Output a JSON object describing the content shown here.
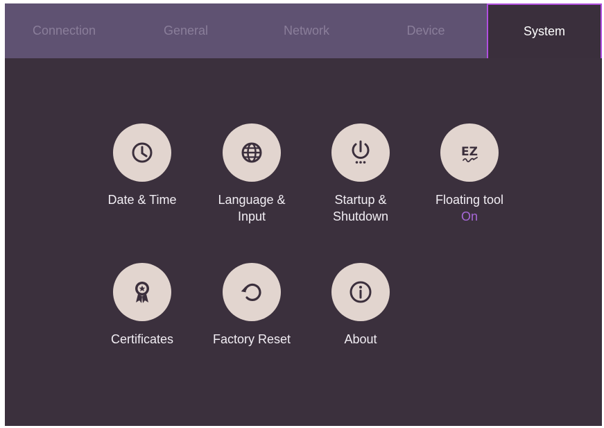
{
  "tabs": [
    {
      "label": "Connection"
    },
    {
      "label": "General"
    },
    {
      "label": "Network"
    },
    {
      "label": "Device"
    },
    {
      "label": "System"
    }
  ],
  "active_tab": "System",
  "items": {
    "date_time": {
      "label": "Date & Time",
      "icon": "clock-icon"
    },
    "language_input": {
      "label": "Language &\nInput",
      "icon": "globe-icon"
    },
    "startup_shutdown": {
      "label": "Startup &\nShutdown",
      "icon": "power-icon"
    },
    "floating_tool": {
      "label": "Floating tool",
      "status": "On",
      "icon": "ez-write-icon"
    },
    "certificates": {
      "label": "Certificates",
      "icon": "award-ribbon-icon"
    },
    "factory_reset": {
      "label": "Factory Reset",
      "icon": "reset-icon"
    },
    "about": {
      "label": "About",
      "icon": "info-icon"
    }
  },
  "colors": {
    "background": "#3b303d",
    "tab_bar": "#5f5272",
    "tab_inactive_text": "#8a7e9a",
    "active_tab_border": "#b14fe0",
    "icon_circle": "#e2d5cf",
    "icon_glyph": "#3b2f3c",
    "status_on": "#a768d8"
  }
}
